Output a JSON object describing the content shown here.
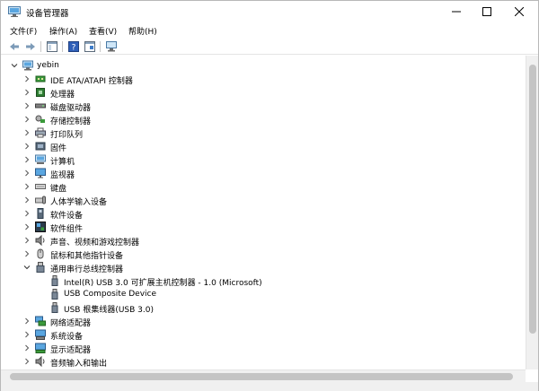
{
  "window": {
    "title": "设备管理器"
  },
  "menu": {
    "file": "文件(F)",
    "action": "操作(A)",
    "view": "查看(V)",
    "help": "帮助(H)"
  },
  "tree": {
    "root": "yebin",
    "categories": [
      {
        "label": "IDE ATA/ATAPI 控制器",
        "icon": "ide-controller-icon"
      },
      {
        "label": "处理器",
        "icon": "processor-icon"
      },
      {
        "label": "磁盘驱动器",
        "icon": "disk-drive-icon"
      },
      {
        "label": "存储控制器",
        "icon": "storage-controller-icon"
      },
      {
        "label": "打印队列",
        "icon": "printer-icon"
      },
      {
        "label": "固件",
        "icon": "firmware-icon"
      },
      {
        "label": "计算机",
        "icon": "computer-icon"
      },
      {
        "label": "监视器",
        "icon": "monitor-icon"
      },
      {
        "label": "键盘",
        "icon": "keyboard-icon"
      },
      {
        "label": "人体学输入设备",
        "icon": "hid-icon"
      },
      {
        "label": "软件设备",
        "icon": "software-device-icon"
      },
      {
        "label": "软件组件",
        "icon": "software-component-icon"
      },
      {
        "label": "声音、视频和游戏控制器",
        "icon": "sound-icon"
      },
      {
        "label": "鼠标和其他指针设备",
        "icon": "mouse-icon"
      },
      {
        "label": "通用串行总线控制器",
        "icon": "usb-icon",
        "expanded": true
      }
    ],
    "usb_children": [
      "Intel(R) USB 3.0 可扩展主机控制器 - 1.0 (Microsoft)",
      "USB Composite Device",
      "USB 根集线器(USB 3.0)"
    ],
    "after": [
      {
        "label": "网络适配器",
        "icon": "network-adapter-icon"
      },
      {
        "label": "系统设备",
        "icon": "system-device-icon"
      },
      {
        "label": "显示适配器",
        "icon": "display-adapter-icon"
      },
      {
        "label": "音频输入和输出",
        "icon": "audio-io-icon"
      }
    ]
  },
  "colors": {
    "accent": "#0078d7"
  }
}
